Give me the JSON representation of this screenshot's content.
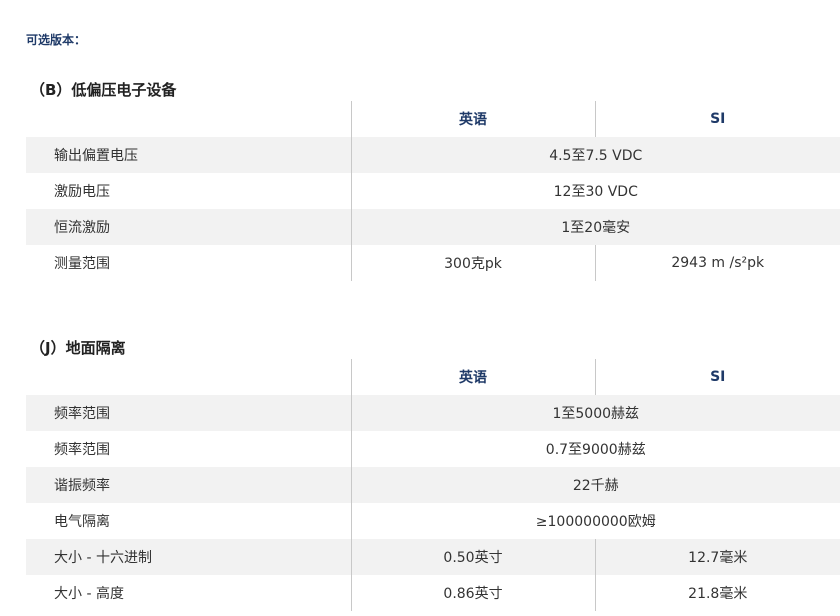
{
  "optional_versions_label": "可选版本：",
  "sections": [
    {
      "title": "（B）低偏压电子设备",
      "col_english": "英语",
      "col_si": "SI",
      "rows": [
        {
          "label": "输出偏置电压",
          "value": "4.5至7.5 VDC"
        },
        {
          "label": "激励电压",
          "value": "12至30 VDC"
        },
        {
          "label": "恒流激励",
          "value": "1至20毫安"
        },
        {
          "label": "测量范围",
          "english": "300克pk",
          "si": "2943 m /s²pk"
        }
      ]
    },
    {
      "title": "（J）地面隔离",
      "col_english": "英语",
      "col_si": "SI",
      "rows": [
        {
          "label": "频率范围",
          "value": "1至5000赫兹"
        },
        {
          "label": "频率范围",
          "value": "0.7至9000赫兹"
        },
        {
          "label": "谐振频率",
          "value": "22千赫"
        },
        {
          "label": "电气隔离",
          "value": "≥100000000欧姆"
        },
        {
          "label": "大小 - 十六进制",
          "english": "0.50英寸",
          "si": "12.7毫米"
        },
        {
          "label": "大小 - 高度",
          "english": "0.86英寸",
          "si": "21.8毫米"
        }
      ]
    }
  ]
}
